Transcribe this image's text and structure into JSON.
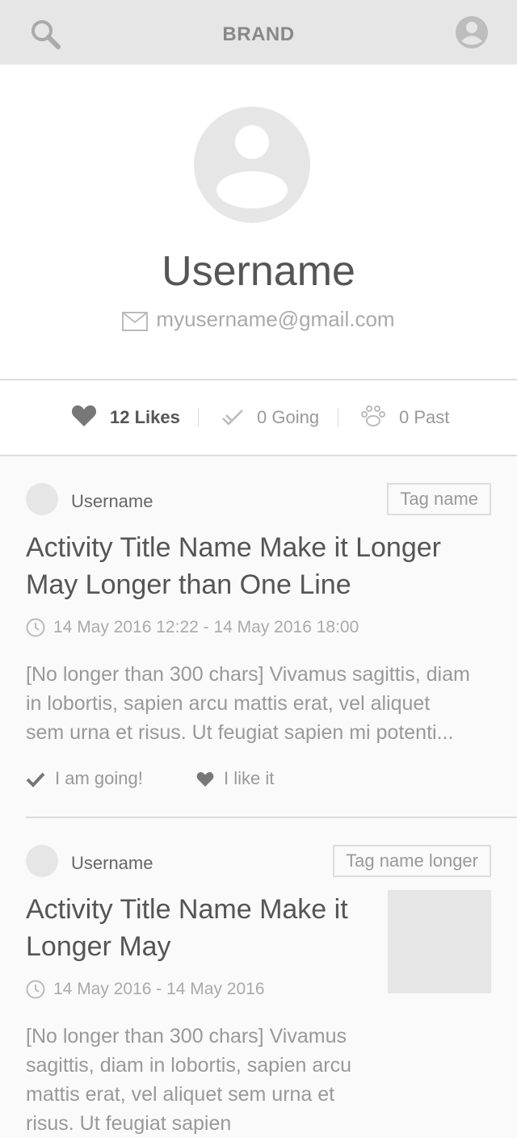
{
  "header": {
    "brand": "BRAND",
    "search_icon": "search-icon",
    "account_icon": "account-icon"
  },
  "profile": {
    "username": "Username",
    "email": "myusername@gmail.com"
  },
  "stats": {
    "likes": "12 Likes",
    "going": "0 Going",
    "past": "0 Past"
  },
  "feed": [
    {
      "author": "Username",
      "tag": "Tag name",
      "title_line1": "Activity Title Name Make it Longer",
      "title_line2": "May Longer than One Line",
      "time": "14 May 2016 12:22 - 14 May 2016 18:00",
      "desc_line1": "[No longer than 300 chars] Vivamus sagittis, diam",
      "desc_line2": "in lobortis, sapien arcu mattis erat, vel aliquet",
      "desc_line3": "sem urna et risus. Ut feugiat sapien mi potenti...",
      "going_label": "I am going!",
      "like_label": "I like it"
    },
    {
      "author": "Username",
      "tag": "Tag name longer",
      "title_line1": "Activity Title Name Make it",
      "title_line2": "Longer May",
      "time": "14 May 2016 - 14 May 2016",
      "desc_line1": "[No longer than 300 chars] Vivamus",
      "desc_line2": "sagittis, diam in lobortis, sapien arcu",
      "desc_line3": "mattis erat, vel aliquet sem urna et",
      "desc_line4": "risus. Ut feugiat sapien"
    }
  ],
  "colors": {
    "header_bg": "#e6e6e6",
    "placeholder": "#e6e6e6",
    "text_dark": "#555555",
    "text_muted": "#999999"
  }
}
